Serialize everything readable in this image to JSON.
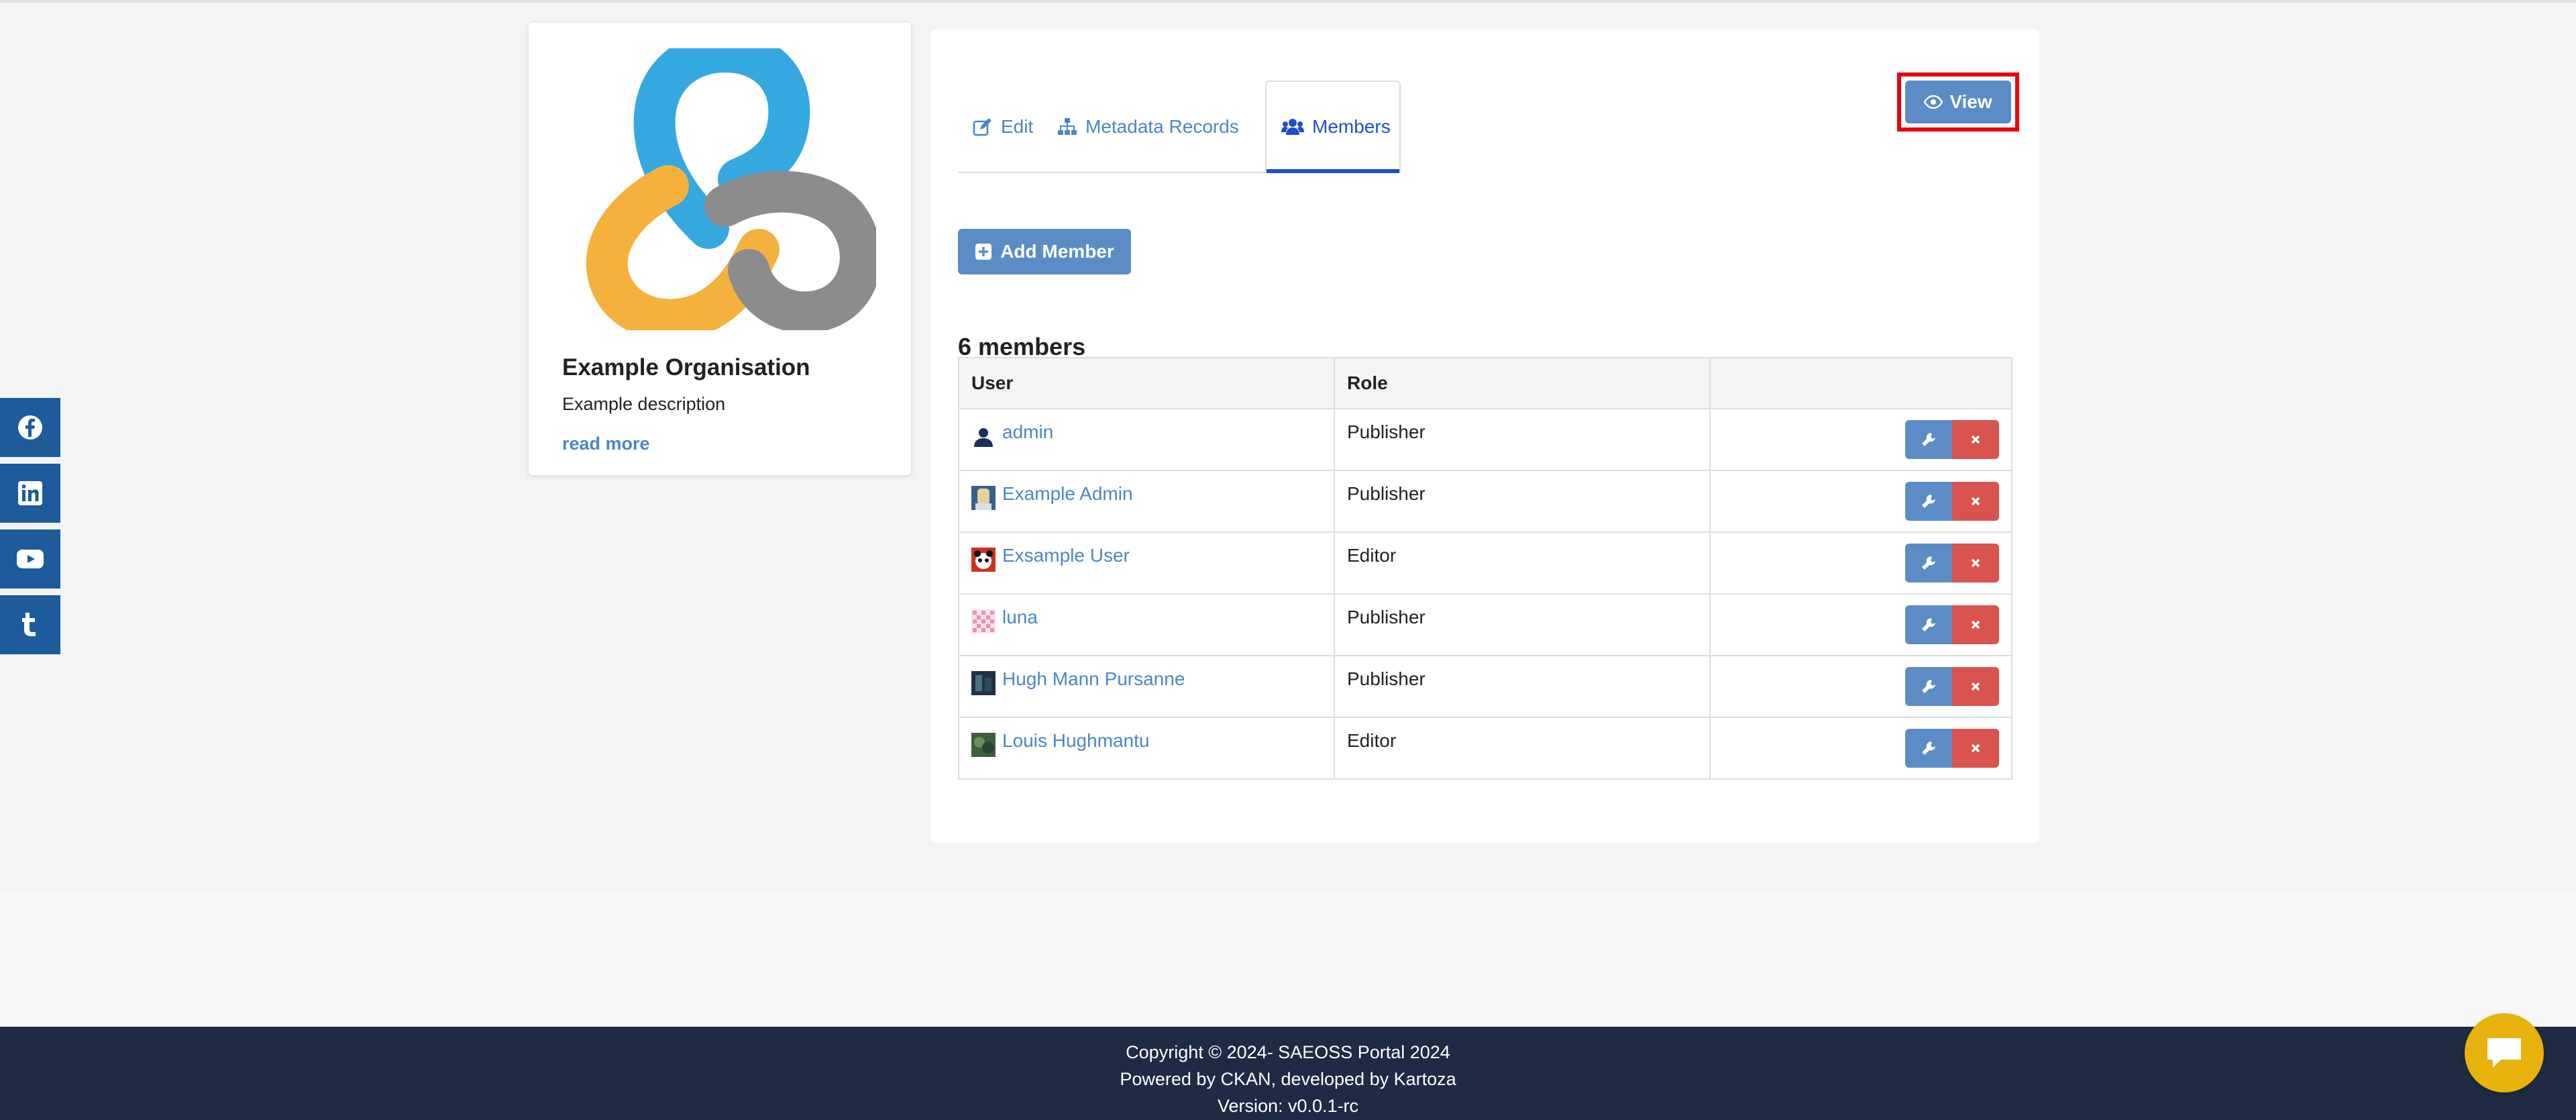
{
  "colors": {
    "primary_button": "#5b8cc6",
    "danger_button": "#d9534f",
    "link": "#4a86c6",
    "active_tab": "#1f4ec9",
    "social_bar": "#1d5b9b",
    "footer_bg": "#1f2a44",
    "chat_button": "#e8b20d",
    "highlight_outline": "#e8000b"
  },
  "social": [
    {
      "icon": "facebook-icon"
    },
    {
      "icon": "linkedin-icon"
    },
    {
      "icon": "youtube-icon"
    },
    {
      "icon": "tumblr-icon"
    }
  ],
  "organisation": {
    "name": "Example Organisation",
    "description": "Example description",
    "read_more": "read more"
  },
  "tabs": {
    "edit": "Edit",
    "metadata": "Metadata Records",
    "members": "Members"
  },
  "actions": {
    "view": "View",
    "add_member": "Add Member"
  },
  "members": {
    "count_label": "6 members",
    "headers": {
      "user": "User",
      "role": "Role",
      "actions": ""
    },
    "rows": [
      {
        "user": "admin",
        "role": "Publisher",
        "avatar": "default-avatar"
      },
      {
        "user": "Example Admin",
        "role": "Publisher",
        "avatar": "photo-avatar"
      },
      {
        "user": "Exsample User",
        "role": "Editor",
        "avatar": "panda-avatar"
      },
      {
        "user": "luna",
        "role": "Publisher",
        "avatar": "identicon-avatar"
      },
      {
        "user": "Hugh Mann Pursanne",
        "role": "Publisher",
        "avatar": "photo-avatar"
      },
      {
        "user": "Louis Hughmantu",
        "role": "Editor",
        "avatar": "photo-avatar"
      }
    ]
  },
  "footer": {
    "copyright": "Copyright © 2024- SAEOSS Portal 2024",
    "powered": "Powered by CKAN, developed by Kartoza",
    "version": "Version: v0.0.1-rc"
  }
}
